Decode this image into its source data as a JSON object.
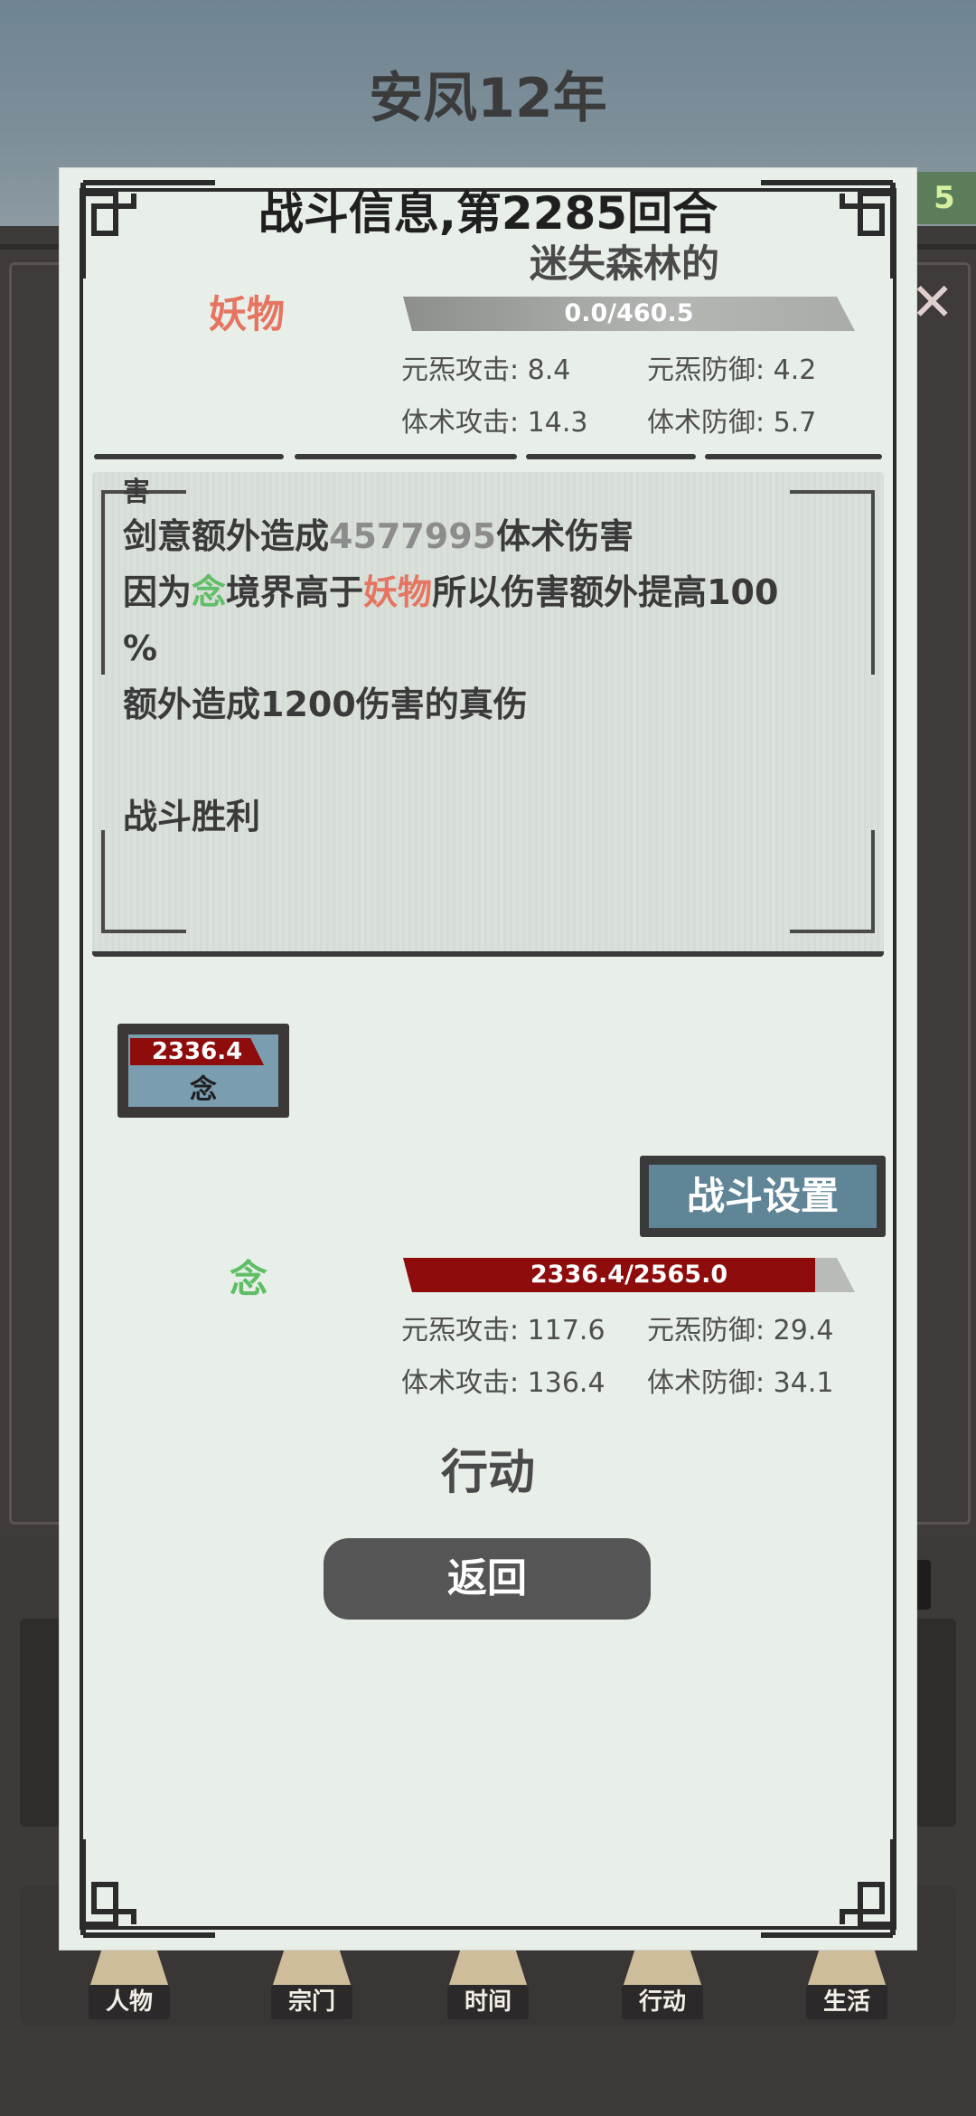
{
  "header": {
    "year_title": "安凤12年",
    "right_pill_value": "5"
  },
  "dialog": {
    "title": "战斗信息,第2285回合",
    "location": "迷失森林的",
    "enemy": {
      "name": "妖物",
      "hp_text": "0.0/460.5",
      "hp_fraction": 0.0,
      "stats": [
        {
          "label": "元炁攻击: 8.4"
        },
        {
          "label": "元炁防御: 4.2"
        },
        {
          "label": "体术攻击: 14.3"
        },
        {
          "label": "体术防御: 5.7"
        }
      ]
    },
    "log": {
      "partial_line": "害",
      "line1_prefix": "剑意额外造成",
      "line1_value": "4577995",
      "line1_suffix": "体术伤害",
      "line2_a": "因为",
      "line2_name_green": "念",
      "line2_b": "境界高于",
      "line2_name_red": "妖物",
      "line2_c": "所以伤害额外提高100",
      "line3": "%",
      "line4": "额外造成1200伤害的真伤",
      "line5": "",
      "line6": "战斗胜利"
    },
    "unit_card": {
      "hp_value": "2336.4",
      "name": "念"
    },
    "settings_button": "战斗设置",
    "player": {
      "name": "念",
      "hp_text": "2336.4/2565.0",
      "hp_fraction": 0.911,
      "stats": [
        {
          "label": "元炁攻击: 117.6"
        },
        {
          "label": "元炁防御: 29.4"
        },
        {
          "label": "体术攻击: 136.4"
        },
        {
          "label": "体术防御: 34.1"
        }
      ]
    },
    "action_label": "行动",
    "back_button": "返回"
  },
  "nav": {
    "items": [
      {
        "label": "人物",
        "icon": "person-icon"
      },
      {
        "label": "宗门",
        "icon": "sect-gate-icon"
      },
      {
        "label": "时间",
        "icon": "incense-burner-icon"
      },
      {
        "label": "行动",
        "icon": "action-figure-icon"
      },
      {
        "label": "生活",
        "icon": "life-fan-icon"
      }
    ]
  },
  "colors": {
    "enemy_name": "#e57560",
    "player_name": "#5fbe66",
    "hp_fill": "#8e0c0c",
    "button_blue": "#5f8597"
  }
}
